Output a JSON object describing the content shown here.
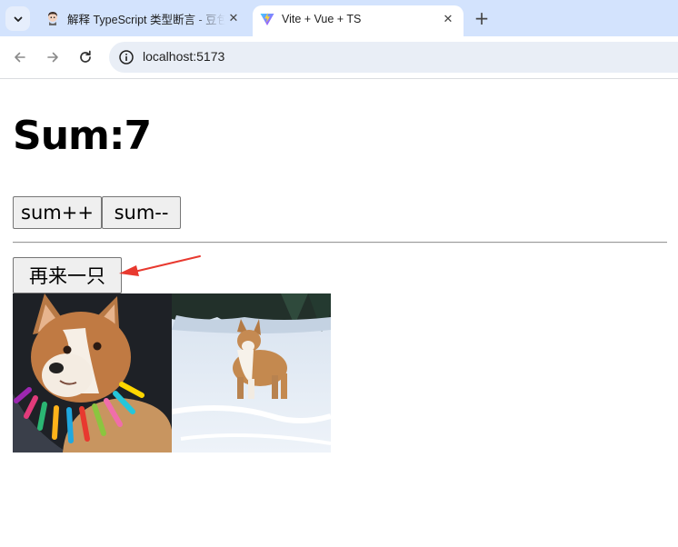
{
  "browser": {
    "tabs": [
      {
        "title": "解释 TypeScript 类型断言 - 豆包",
        "active": false
      },
      {
        "title": "Vite + Vue + TS",
        "active": true
      }
    ],
    "close_glyph": "✕",
    "new_tab_glyph": "+",
    "url": "localhost:5173"
  },
  "page": {
    "sum_label": "Sum:7",
    "sum_value": 7,
    "increment_button": "sum++",
    "decrement_button": "sum--",
    "more_button": "再来一只",
    "annotation_color": "#e8392f",
    "images": [
      {
        "name": "corgi-with-colorful-collar"
      },
      {
        "name": "corgi-in-snow"
      }
    ]
  }
}
